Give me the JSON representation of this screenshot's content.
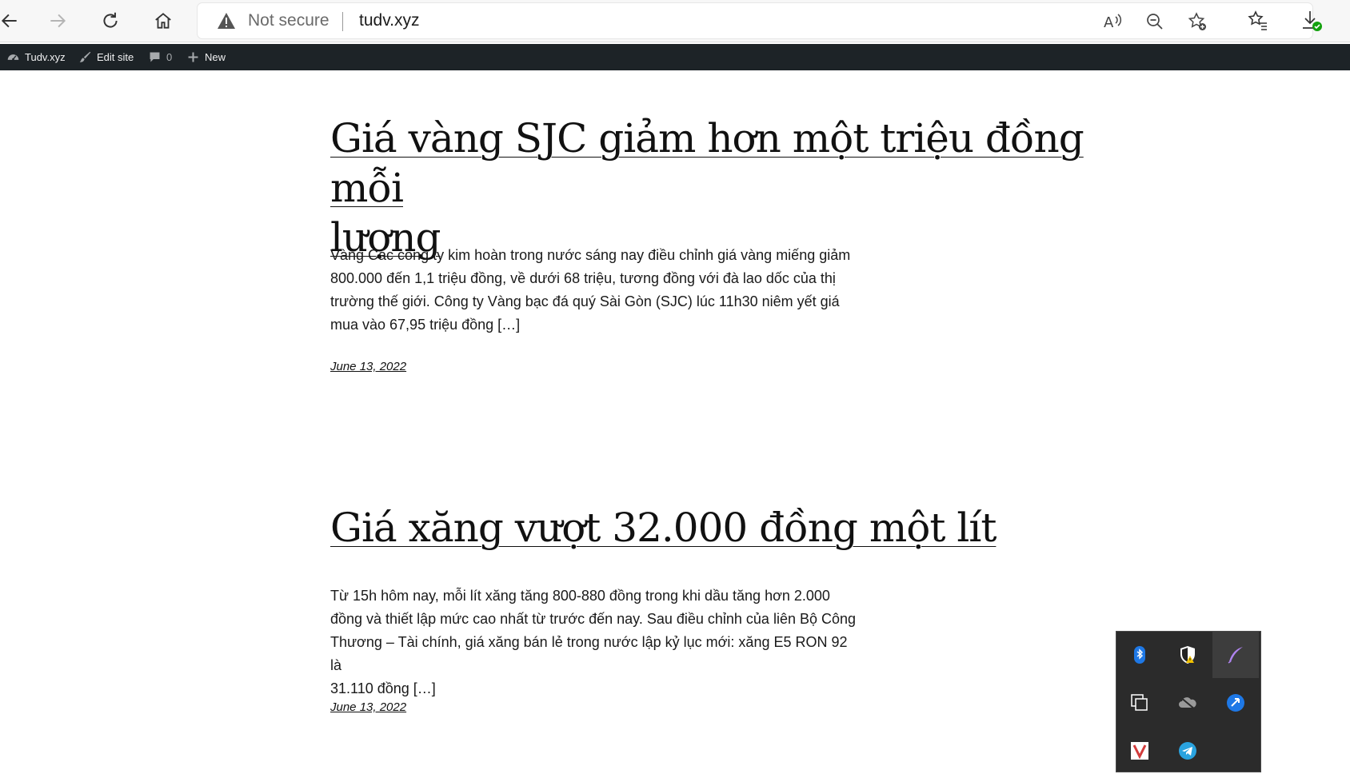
{
  "browser": {
    "security_label": "Not secure",
    "url": "tudv.xyz",
    "icons": [
      "back-icon",
      "forward-icon",
      "refresh-icon",
      "home-icon",
      "warning-icon",
      "read-aloud-icon",
      "zoom-out-icon",
      "add-favorite-icon",
      "favorites-icon",
      "downloads-icon"
    ]
  },
  "admin_bar": {
    "site_name": "Tudv.xyz",
    "edit_site": "Edit site",
    "comments_count": "0",
    "new_label": "New"
  },
  "posts": [
    {
      "title_line1": "Giá vàng SJC giảm hơn một triệu đồng mỗi",
      "title_line2": "lượng",
      "excerpt_lines": [
        "Vàng Các công ty kim hoàn trong nước sáng nay điều chỉnh giá vàng miếng giảm",
        "800.000 đến 1,1 triệu đồng, về dưới 68 triệu, tương đồng với đà lao dốc của thị",
        "trường thế giới. Công ty Vàng bạc đá quý Sài Gòn (SJC) lúc 11h30 niêm yết giá",
        "mua vào 67,95 triệu đồng […]"
      ],
      "date": "June 13, 2022"
    },
    {
      "title_line1": "Giá xăng vượt 32.000 đồng một lít",
      "excerpt_lines": [
        "Từ 15h hôm nay, mỗi lít xăng tăng 800-880 đồng trong khi dầu tăng hơn 2.000",
        "đồng và thiết lập mức cao nhất từ trước đến nay. Sau điều chỉnh của liên Bộ Công",
        "Thương – Tài chính, giá xăng bán lẻ trong nước lập kỷ lục mới: xăng E5 RON 92 là",
        "31.110 đồng […]"
      ],
      "date": "June 13, 2022"
    }
  ],
  "tray": {
    "icons": [
      "bluetooth-icon",
      "security-shield-icon",
      "pen-icon",
      "copy-icon",
      "onedrive-icon",
      "app-icon",
      "vivaldi-icon",
      "telegram-icon"
    ]
  },
  "colors": {
    "admin_bar_bg": "#1d2327",
    "tray_bg": "#2b2b2b",
    "download_badge": "#13a10e"
  }
}
